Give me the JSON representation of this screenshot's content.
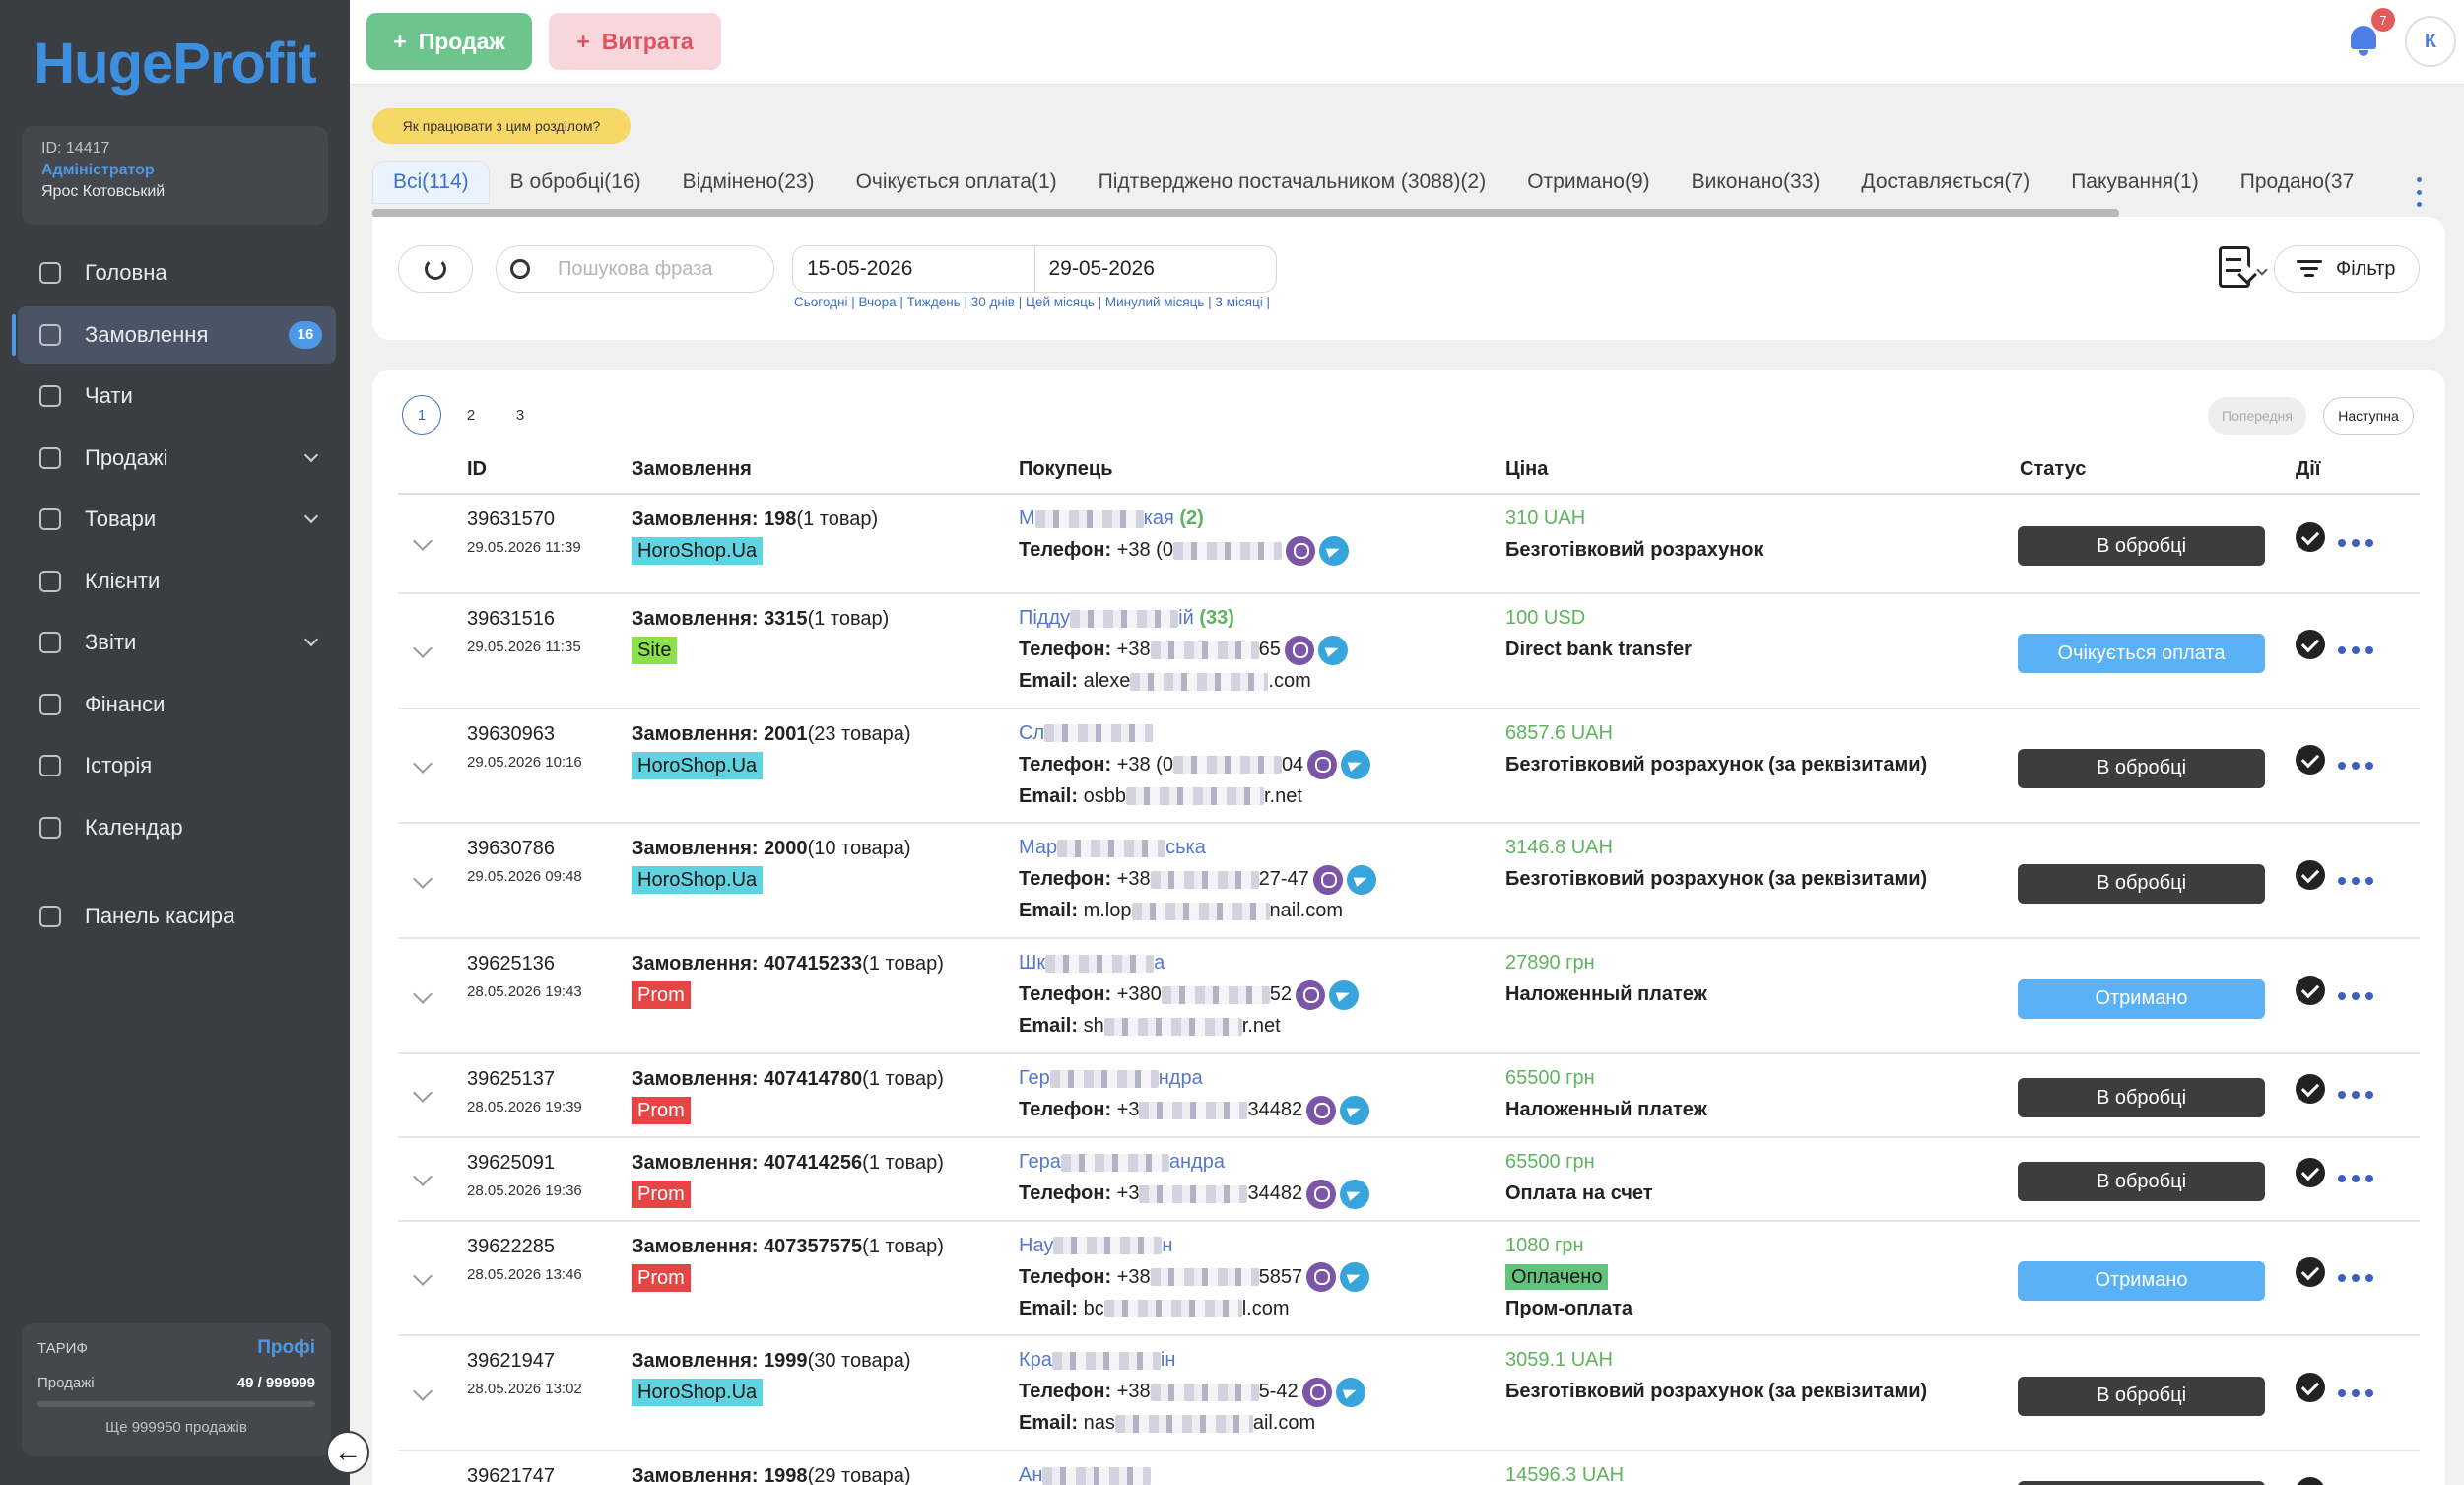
{
  "brand": {
    "logo_text": "HugeProfit"
  },
  "user": {
    "id_line": "ID: 14417",
    "role": "Адміністратор",
    "name": "Ярос Котовський"
  },
  "nav": [
    {
      "label": "Головна",
      "icon": "home-icon",
      "active": false,
      "has_chevron": false,
      "badge": ""
    },
    {
      "label": "Замовлення",
      "icon": "orders-icon",
      "active": true,
      "has_chevron": false,
      "badge": "16"
    },
    {
      "label": "Чати",
      "icon": "chat-icon",
      "active": false,
      "has_chevron": false,
      "badge": ""
    },
    {
      "label": "Продажі",
      "icon": "cart-icon",
      "active": false,
      "has_chevron": true,
      "badge": ""
    },
    {
      "label": "Товари",
      "icon": "box-icon",
      "active": false,
      "has_chevron": true,
      "badge": ""
    },
    {
      "label": "Клієнти",
      "icon": "user-icon",
      "active": false,
      "has_chevron": false,
      "badge": ""
    },
    {
      "label": "Звіти",
      "icon": "report-icon",
      "active": false,
      "has_chevron": true,
      "badge": ""
    },
    {
      "label": "Фінанси",
      "icon": "finance-icon",
      "active": false,
      "has_chevron": false,
      "badge": ""
    },
    {
      "label": "Історія",
      "icon": "history-icon",
      "active": false,
      "has_chevron": false,
      "badge": ""
    },
    {
      "label": "Календар",
      "icon": "calendar-icon",
      "active": false,
      "has_chevron": false,
      "badge": ""
    }
  ],
  "cashier": {
    "label": "Панель касира",
    "icon": "store-icon"
  },
  "tariff": {
    "title": "ТАРИФ",
    "plan": "Профі",
    "sales_label": "Продажі",
    "sales_count": "49 / 999999",
    "note": "Ще 999950 продажів"
  },
  "toolbar": {
    "sale_label": "Продаж",
    "expense_label": "Витрата",
    "notifications_count": "7",
    "avatar_letter": "К"
  },
  "help": {
    "label": "Як працювати з цим розділом?"
  },
  "tabs": [
    {
      "label": "Всі(114)",
      "active": true
    },
    {
      "label": "В обробці(16)",
      "active": false
    },
    {
      "label": "Відмінено(23)",
      "active": false
    },
    {
      "label": "Очікується оплата(1)",
      "active": false
    },
    {
      "label": "Підтверджено постачальником (3088)(2)",
      "active": false
    },
    {
      "label": "Отримано(9)",
      "active": false
    },
    {
      "label": "Виконано(33)",
      "active": false
    },
    {
      "label": "Доставляється(7)",
      "active": false
    },
    {
      "label": "Пакування(1)",
      "active": false
    },
    {
      "label": "Продано(37",
      "active": false
    }
  ],
  "filters": {
    "search_placeholder": "Пошукова фраза",
    "date_from": "15-05-2026",
    "date_to": "29-05-2026",
    "presets": "Сьогодні | Вчора | Тиждень | 30 днів | Цей місяць | Минулий місяць | 3 місяці |",
    "filter_label": "Фільтр"
  },
  "pagination": {
    "pages": [
      "1",
      "2",
      "3"
    ],
    "active_page": "1",
    "prev_label": "Попередня",
    "next_label": "Наступна"
  },
  "table": {
    "headers": {
      "id": "ID",
      "order": "Замовлення",
      "buyer": "Покупець",
      "price": "Ціна",
      "status": "Статус",
      "actions": "Дії"
    },
    "phone_label": "Телефон:",
    "email_label": "Email:",
    "rows": [
      {
        "id": "39631570",
        "date": "29.05.2026 11:39",
        "order_label": "Замовлення:",
        "order_no": "198",
        "items": "(1 товар)",
        "source": "HoroShop.Ua",
        "source_type": "horoshop",
        "buyer_prefix": "М",
        "buyer_suffix": "кая",
        "buyer_count": "(2)",
        "phone_prefix": "+38 (0",
        "phone_suffix": "",
        "email_prefix": "",
        "email_suffix": "",
        "amount": "310 UAH",
        "paid_tag": "",
        "pay_method": "Безготівковий розрахунок",
        "status": "В обробці",
        "status_style": "dark"
      },
      {
        "id": "39631516",
        "date": "29.05.2026 11:35",
        "order_label": "Замовлення:",
        "order_no": "3315",
        "items": "(1 товар)",
        "source": "Site",
        "source_type": "site",
        "buyer_prefix": "Підду",
        "buyer_suffix": "ій",
        "buyer_count": "(33)",
        "phone_prefix": "+38",
        "phone_suffix": "65",
        "email_prefix": "alexe",
        "email_suffix": ".com",
        "amount": "100 USD",
        "paid_tag": "",
        "pay_method": "Direct bank transfer",
        "status": "Очікується оплата",
        "status_style": "light"
      },
      {
        "id": "39630963",
        "date": "29.05.2026 10:16",
        "order_label": "Замовлення:",
        "order_no": "2001",
        "items": "(23 товара)",
        "source": "HoroShop.Ua",
        "source_type": "horoshop",
        "buyer_prefix": "Сл",
        "buyer_suffix": "",
        "buyer_count": "",
        "phone_prefix": "+38 (0",
        "phone_suffix": "04",
        "email_prefix": "osbb",
        "email_suffix": "r.net",
        "amount": "6857.6 UAH",
        "paid_tag": "",
        "pay_method": "Безготівковий розрахунок (за реквізитами)",
        "status": "В обробці",
        "status_style": "dark"
      },
      {
        "id": "39630786",
        "date": "29.05.2026 09:48",
        "order_label": "Замовлення:",
        "order_no": "2000",
        "items": "(10 товара)",
        "source": "HoroShop.Ua",
        "source_type": "horoshop",
        "buyer_prefix": "Мар",
        "buyer_suffix": "ська",
        "buyer_count": "",
        "phone_prefix": "+38",
        "phone_suffix": "27-47",
        "email_prefix": "m.lop",
        "email_suffix": "nail.com",
        "amount": "3146.8 UAH",
        "paid_tag": "",
        "pay_method": "Безготівковий розрахунок (за реквізитами)",
        "status": "В обробці",
        "status_style": "dark"
      },
      {
        "id": "39625136",
        "date": "28.05.2026 19:43",
        "order_label": "Замовлення:",
        "order_no": "407415233",
        "items": "(1 товар)",
        "source": "Prom",
        "source_type": "prom",
        "buyer_prefix": "Шк",
        "buyer_suffix": "а",
        "buyer_count": "",
        "phone_prefix": "+380",
        "phone_suffix": "52",
        "email_prefix": "sh",
        "email_suffix": "r.net",
        "amount": "27890 грн",
        "paid_tag": "",
        "pay_method": "Наложенный платеж",
        "status": "Отримано",
        "status_style": "light"
      },
      {
        "id": "39625137",
        "date": "28.05.2026 19:39",
        "order_label": "Замовлення:",
        "order_no": "407414780",
        "items": "(1 товар)",
        "source": "Prom",
        "source_type": "prom",
        "buyer_prefix": "Гер",
        "buyer_suffix": "ндра",
        "buyer_count": "",
        "phone_prefix": "+3",
        "phone_suffix": "34482",
        "email_prefix": "",
        "email_suffix": "",
        "amount": "65500 грн",
        "paid_tag": "",
        "pay_method": "Наложенный платеж",
        "status": "В обробці",
        "status_style": "dark"
      },
      {
        "id": "39625091",
        "date": "28.05.2026 19:36",
        "order_label": "Замовлення:",
        "order_no": "407414256",
        "items": "(1 товар)",
        "source": "Prom",
        "source_type": "prom",
        "buyer_prefix": "Гера",
        "buyer_suffix": "андра",
        "buyer_count": "",
        "phone_prefix": "+3",
        "phone_suffix": "34482",
        "email_prefix": "",
        "email_suffix": "",
        "amount": "65500 грн",
        "paid_tag": "",
        "pay_method": "Оплата на счет",
        "status": "В обробці",
        "status_style": "dark"
      },
      {
        "id": "39622285",
        "date": "28.05.2026 13:46",
        "order_label": "Замовлення:",
        "order_no": "407357575",
        "items": "(1 товар)",
        "source": "Prom",
        "source_type": "prom",
        "buyer_prefix": "Нау",
        "buyer_suffix": "н",
        "buyer_count": "",
        "phone_prefix": "+38",
        "phone_suffix": "5857",
        "email_prefix": "bc",
        "email_suffix": "l.com",
        "amount": "1080 грн",
        "paid_tag": "Оплачено",
        "pay_method": "Пром-оплата",
        "status": "Отримано",
        "status_style": "light"
      },
      {
        "id": "39621947",
        "date": "28.05.2026 13:02",
        "order_label": "Замовлення:",
        "order_no": "1999",
        "items": "(30 товара)",
        "source": "HoroShop.Ua",
        "source_type": "horoshop",
        "buyer_prefix": "Кра",
        "buyer_suffix": "ін",
        "buyer_count": "",
        "phone_prefix": "+38",
        "phone_suffix": "5-42",
        "email_prefix": "nas",
        "email_suffix": "ail.com",
        "amount": "3059.1 UAH",
        "paid_tag": "",
        "pay_method": "Безготівковий розрахунок (за реквізитами)",
        "status": "В обробці",
        "status_style": "dark"
      },
      {
        "id": "39621747",
        "date": "",
        "order_label": "Замовлення:",
        "order_no": "1998",
        "items": "(29 товара)",
        "source": "",
        "source_type": "horoshop",
        "buyer_prefix": "Ан",
        "buyer_suffix": "",
        "buyer_count": "",
        "phone_prefix": "",
        "phone_suffix": "",
        "email_prefix": "",
        "email_suffix": "",
        "amount": "14596.3 UAH",
        "paid_tag": "",
        "pay_method": "",
        "status": "",
        "status_style": "dark"
      }
    ]
  }
}
